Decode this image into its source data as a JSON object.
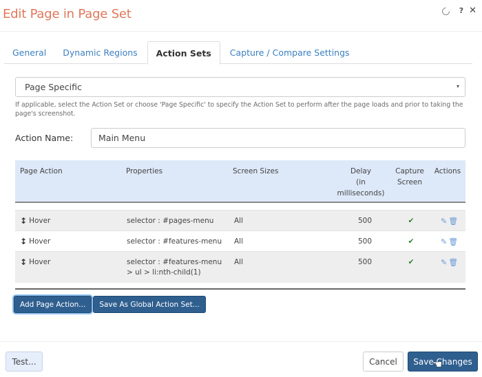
{
  "dialog": {
    "title": "Edit Page in Page Set",
    "header_icons": {
      "refresh": "refresh-icon",
      "help": "?",
      "close": "✕"
    }
  },
  "tabs": [
    {
      "label": "General",
      "active": false
    },
    {
      "label": "Dynamic Regions",
      "active": false
    },
    {
      "label": "Action Sets",
      "active": true
    },
    {
      "label": "Capture / Compare Settings",
      "active": false
    }
  ],
  "action_set_select": {
    "value": "Page Specific",
    "caret": "▾",
    "help_text": "If applicable, select the Action Set or choose 'Page Specific' to specify the Action Set to perform after the page loads and prior to taking the page's screenshot."
  },
  "action_name": {
    "label": "Action Name:",
    "value": "Main Menu"
  },
  "table": {
    "headers": {
      "page_action": "Page Action",
      "properties": "Properties",
      "screen_sizes": "Screen Sizes",
      "delay_line1": "Delay",
      "delay_line2": "(in",
      "delay_line3": "milliseconds)",
      "capture_line1": "Capture",
      "capture_line2": "Screen",
      "actions": "Actions"
    },
    "rows": [
      {
        "page_action": "Hover",
        "properties": "selector : #pages-menu",
        "screen_sizes": "All",
        "delay": "500",
        "capture_screen": "✔"
      },
      {
        "page_action": "Hover",
        "properties": "selector : #features-menu",
        "screen_sizes": "All",
        "delay": "500",
        "capture_screen": "✔"
      },
      {
        "page_action": "Hover",
        "properties": "selector : #features-menu > ul > li:nth-child(1)",
        "screen_sizes": "All",
        "delay": "500",
        "capture_screen": "✔"
      }
    ],
    "icons": {
      "drag": "↕",
      "edit": "✎",
      "delete": "🗑"
    }
  },
  "buttons": {
    "add_page_action": "Add Page Action...",
    "save_global": "Save As Global Action Set...",
    "test": "Test...",
    "cancel": "Cancel",
    "save_changes": "Save Changes"
  },
  "colors": {
    "title": "#e0775a",
    "tab_link": "#3a7fc0",
    "primary_button": "#2f5f8f",
    "table_header_bg": "#dde8f8",
    "check": "#2e7d32",
    "action_icons": "#6a9ad8"
  }
}
